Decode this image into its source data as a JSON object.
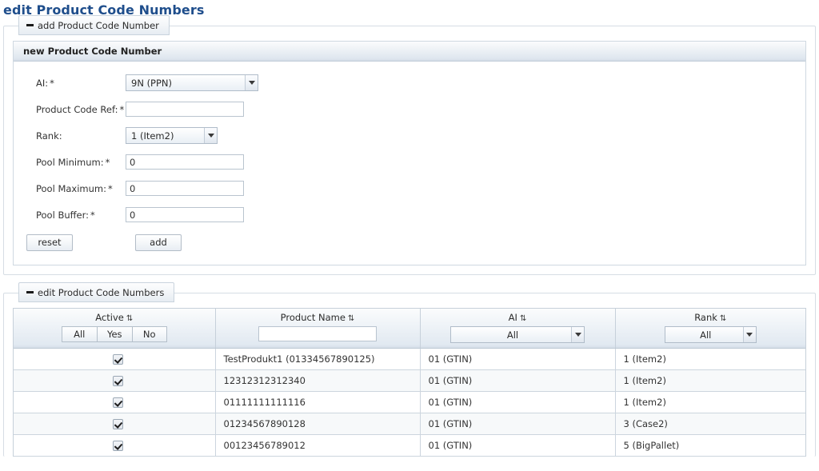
{
  "page": {
    "title": "edit Product Code Numbers"
  },
  "add_section": {
    "legend": "add Product Code Number",
    "panel_title": "new Product Code Number",
    "fields": [
      {
        "label": "AI:",
        "required": "*",
        "type": "select",
        "value": "9N (PPN)"
      },
      {
        "label": "Product Code Ref:",
        "required": "*",
        "type": "text",
        "value": "",
        "placeholder": ""
      },
      {
        "label": "Rank:",
        "required": "",
        "type": "select",
        "value": "1 (Item2)"
      },
      {
        "label": "Pool Minimum:",
        "required": "*",
        "type": "text",
        "value": "0",
        "placeholder": ""
      },
      {
        "label": "Pool Maximum:",
        "required": "*",
        "type": "text",
        "value": "0",
        "placeholder": ""
      },
      {
        "label": "Pool Buffer:",
        "required": "*",
        "type": "text",
        "value": "0",
        "placeholder": ""
      }
    ],
    "buttons": {
      "reset": "reset",
      "add": "add"
    }
  },
  "edit_section": {
    "legend": "edit Product Code Numbers",
    "table": {
      "columns": [
        {
          "title": "Active",
          "sort_icon": "sort-updown-icon",
          "filter": "buttons"
        },
        {
          "title": "Product Name",
          "sort_icon": "sort-updown-icon",
          "filter": "text"
        },
        {
          "title": "AI",
          "sort_icon": "sort-updown-icon",
          "filter": "select"
        },
        {
          "title": "Rank",
          "sort_icon": "sort-updown-icon",
          "filter": "select"
        }
      ],
      "filters": {
        "active_buttons": [
          "All",
          "Yes",
          "No"
        ],
        "product_name_value": "",
        "product_name_placeholder": "",
        "ai_value": "All",
        "rank_value": "All"
      },
      "rows": [
        {
          "active": true,
          "product_name": "TestProdukt1 (01334567890125)",
          "ai": "01 (GTIN)",
          "rank": "1 (Item2)"
        },
        {
          "active": true,
          "product_name": "12312312312340",
          "ai": "01 (GTIN)",
          "rank": "1 (Item2)"
        },
        {
          "active": true,
          "product_name": "01111111111116",
          "ai": "01 (GTIN)",
          "rank": "1 (Item2)"
        },
        {
          "active": true,
          "product_name": "01234567890128",
          "ai": "01 (GTIN)",
          "rank": "3 (Case2)"
        },
        {
          "active": true,
          "product_name": "00123456789012",
          "ai": "01 (GTIN)",
          "rank": "5 (BigPallet)"
        }
      ]
    }
  },
  "icons": {
    "sort_updown": "⇅",
    "collapse": "collapse-minus-icon",
    "dropdown": "chevron-down-icon",
    "checkbox_checked": "checkbox-checked-icon"
  },
  "colors": {
    "title": "#1f4e8c",
    "border": "#c6d0da",
    "header_gradient_top": "#fbfcfd",
    "header_gradient_bottom": "#d5dee8"
  }
}
